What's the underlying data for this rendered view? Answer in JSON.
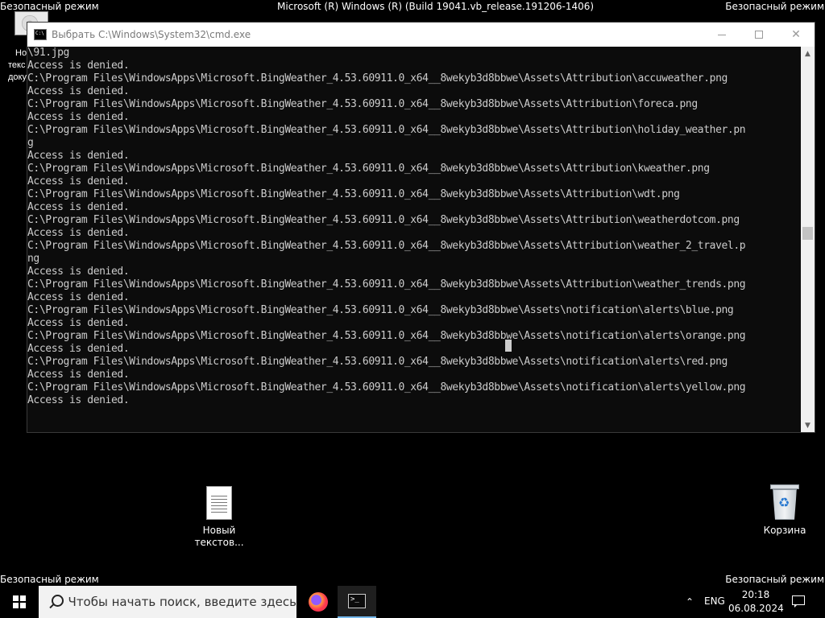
{
  "desktop": {
    "safe_mode_label": "Безопасный режим",
    "build_info": "Microsoft (R) Windows (R) (Build 19041.vb_release.191206-1406)",
    "partial_icon_lines": [
      "Но",
      "текс",
      "доку"
    ],
    "icons": [
      {
        "label_line1": "Новый",
        "label_line2": "текстов...",
        "icon": "text-document-icon"
      },
      {
        "label_line1": "Корзина",
        "icon": "recycle-bin-icon"
      }
    ]
  },
  "cmd_window": {
    "title": "Выбрать C:\\Windows\\System32\\cmd.exe",
    "controls": {
      "minimize": "minimize",
      "maximize": "maximize",
      "close": "✕"
    },
    "lines": [
      "\\91.jpg",
      "Access is denied.",
      "C:\\Program Files\\WindowsApps\\Microsoft.BingWeather_4.53.60911.0_x64__8wekyb3d8bbwe\\Assets\\Attribution\\accuweather.png",
      "Access is denied.",
      "C:\\Program Files\\WindowsApps\\Microsoft.BingWeather_4.53.60911.0_x64__8wekyb3d8bbwe\\Assets\\Attribution\\foreca.png",
      "Access is denied.",
      "C:\\Program Files\\WindowsApps\\Microsoft.BingWeather_4.53.60911.0_x64__8wekyb3d8bbwe\\Assets\\Attribution\\holiday_weather.pn",
      "g",
      "Access is denied.",
      "C:\\Program Files\\WindowsApps\\Microsoft.BingWeather_4.53.60911.0_x64__8wekyb3d8bbwe\\Assets\\Attribution\\kweather.png",
      "Access is denied.",
      "C:\\Program Files\\WindowsApps\\Microsoft.BingWeather_4.53.60911.0_x64__8wekyb3d8bbwe\\Assets\\Attribution\\wdt.png",
      "Access is denied.",
      "C:\\Program Files\\WindowsApps\\Microsoft.BingWeather_4.53.60911.0_x64__8wekyb3d8bbwe\\Assets\\Attribution\\weatherdotcom.png",
      "Access is denied.",
      "C:\\Program Files\\WindowsApps\\Microsoft.BingWeather_4.53.60911.0_x64__8wekyb3d8bbwe\\Assets\\Attribution\\weather_2_travel.p",
      "ng",
      "Access is denied.",
      "C:\\Program Files\\WindowsApps\\Microsoft.BingWeather_4.53.60911.0_x64__8wekyb3d8bbwe\\Assets\\Attribution\\weather_trends.png",
      "Access is denied.",
      "C:\\Program Files\\WindowsApps\\Microsoft.BingWeather_4.53.60911.0_x64__8wekyb3d8bbwe\\Assets\\notification\\alerts\\blue.png",
      "Access is denied.",
      "C:\\Program Files\\WindowsApps\\Microsoft.BingWeather_4.53.60911.0_x64__8wekyb3d8bbwe\\Assets\\notification\\alerts\\orange.png",
      "Access is denied.",
      "C:\\Program Files\\WindowsApps\\Microsoft.BingWeather_4.53.60911.0_x64__8wekyb3d8bbwe\\Assets\\notification\\alerts\\red.png",
      "Access is denied.",
      "C:\\Program Files\\WindowsApps\\Microsoft.BingWeather_4.53.60911.0_x64__8wekyb3d8bbwe\\Assets\\notification\\alerts\\yellow.png",
      "Access is denied."
    ]
  },
  "taskbar": {
    "search_placeholder": "Чтобы начать поиск, введите здесь",
    "apps": [
      {
        "icon": "firefox-icon"
      },
      {
        "icon": "cmd-icon",
        "active": true
      }
    ],
    "tray": {
      "language": "ENG",
      "time": "20:18",
      "date": "06.08.2024"
    }
  },
  "colors": {
    "console_bg": "#0c0c0c",
    "console_text": "#cccccc",
    "taskbar_bg": "#000000",
    "active_accent": "#76b9ed"
  }
}
